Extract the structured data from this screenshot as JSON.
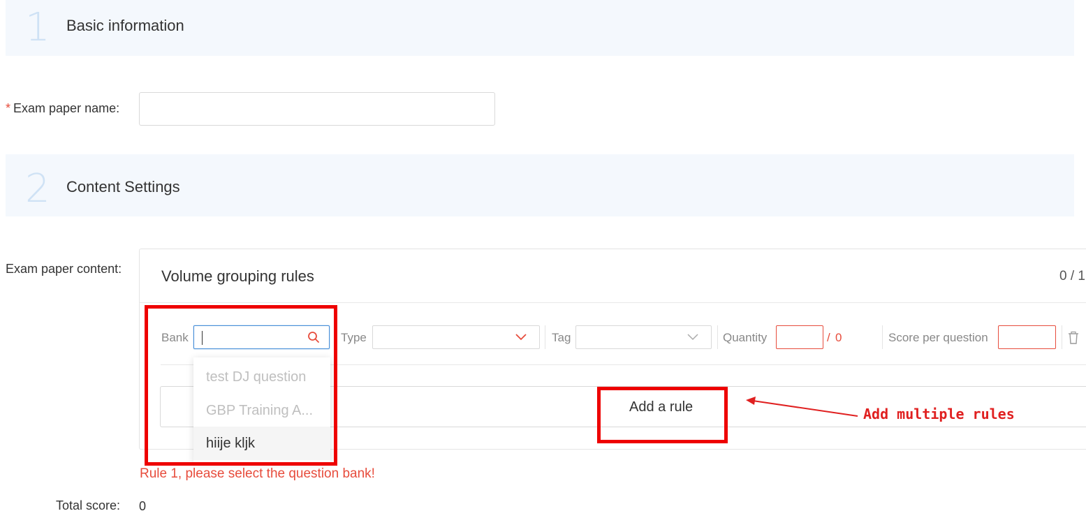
{
  "steps": [
    {
      "number": "1",
      "title": "Basic information"
    },
    {
      "number": "2",
      "title": "Content Settings"
    }
  ],
  "form": {
    "exam_name_label": "Exam paper name",
    "exam_name_colon": ":",
    "exam_name_value": "",
    "content_label": "Exam paper content",
    "content_colon": ":",
    "total_score_label": "Total score",
    "total_score_colon": ":",
    "total_score_value": "0"
  },
  "rules_card": {
    "title": "Volume grouping rules",
    "count": "0 / 1",
    "rule": {
      "bank_label": "Bank",
      "bank_value": "",
      "type_label": "Type",
      "tag_label": "Tag",
      "quantity_label": "Quantity",
      "quantity_separator": "/",
      "quantity_max": "0",
      "score_label": "Score per question"
    },
    "add_rule_label": "Add a rule"
  },
  "bank_dropdown": {
    "options": [
      {
        "label": "test DJ question",
        "state": "disabled"
      },
      {
        "label": "GBP Training A...",
        "state": "disabled"
      },
      {
        "label": "hiije kljk",
        "state": "hover"
      }
    ]
  },
  "validation": {
    "error": "Rule 1, please select the question bank!"
  },
  "annotation": {
    "text": "Add multiple rules",
    "color": "#e02020"
  },
  "colors": {
    "accent_blue": "#4a90d9",
    "error_red": "#e74c3c",
    "step_bg": "#f4f8fd",
    "step_number": "#cfe2f5"
  },
  "icons": {
    "bank_search": "search-icon",
    "type_caret": "chevron-down-icon",
    "tag_caret": "chevron-down-icon",
    "delete": "trash-icon",
    "annotation_arrow": "arrow-left-icon"
  }
}
